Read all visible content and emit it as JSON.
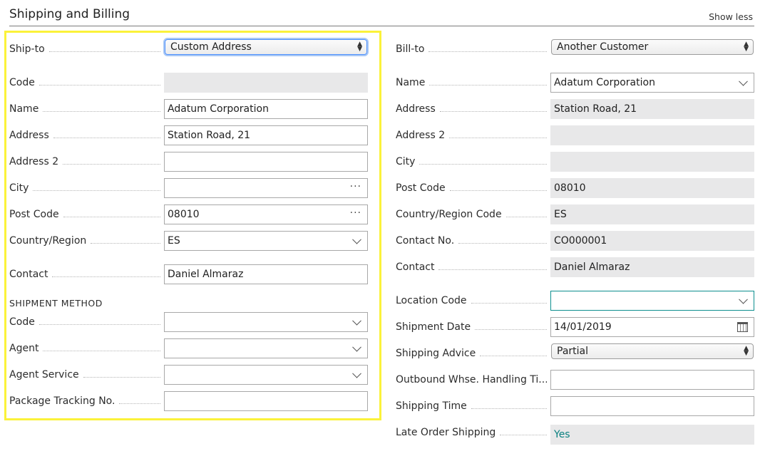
{
  "header": {
    "title": "Shipping and Billing",
    "show_less": "Show less"
  },
  "ship": {
    "ship_to_label": "Ship-to",
    "ship_to_value": "Custom Address",
    "code_label": "Code",
    "code_value": "",
    "name_label": "Name",
    "name_value": "Adatum Corporation",
    "address_label": "Address",
    "address_value": "Station Road, 21",
    "address2_label": "Address 2",
    "address2_value": "",
    "city_label": "City",
    "city_value": "",
    "post_code_label": "Post Code",
    "post_code_value": "08010",
    "country_label": "Country/Region",
    "country_value": "ES",
    "contact_label": "Contact",
    "contact_value": "Daniel Almaraz",
    "section_title": "SHIPMENT METHOD",
    "method_code_label": "Code",
    "method_code_value": "",
    "agent_label": "Agent",
    "agent_value": "",
    "agent_service_label": "Agent Service",
    "agent_service_value": "",
    "tracking_label": "Package Tracking No.",
    "tracking_value": ""
  },
  "bill": {
    "bill_to_label": "Bill-to",
    "bill_to_value": "Another Customer",
    "name_label": "Name",
    "name_value": "Adatum Corporation",
    "address_label": "Address",
    "address_value": "Station Road, 21",
    "address2_label": "Address 2",
    "address2_value": "",
    "city_label": "City",
    "city_value": "",
    "post_code_label": "Post Code",
    "post_code_value": "08010",
    "country_label": "Country/Region Code",
    "country_value": "ES",
    "contact_no_label": "Contact No.",
    "contact_no_value": "CO000001",
    "contact_label": "Contact",
    "contact_value": "Daniel Almaraz",
    "location_label": "Location Code",
    "location_value": "",
    "shipment_date_label": "Shipment Date",
    "shipment_date_value": "14/01/2019",
    "shipping_advice_label": "Shipping Advice",
    "shipping_advice_value": "Partial",
    "outbound_label": "Outbound Whse. Handling Ti...",
    "outbound_value": "",
    "shipping_time_label": "Shipping Time",
    "shipping_time_value": "",
    "late_label": "Late Order Shipping",
    "late_value": "Yes"
  },
  "colors": {
    "highlight": "#fbf23a",
    "teal": "#0a8080"
  },
  "icons": [
    "select-arrows-icon",
    "chevron-down-icon",
    "ellipsis-icon",
    "calendar-icon"
  ]
}
